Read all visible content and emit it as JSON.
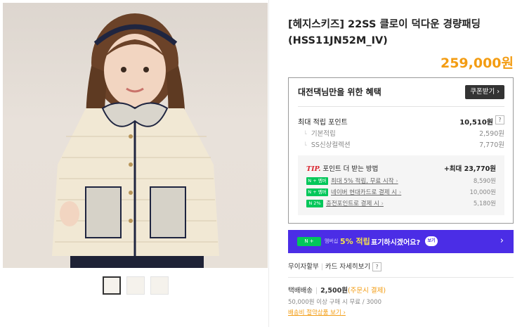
{
  "product": {
    "title": "[헤지스키즈] 22SS 클로이 덕다운 경량패딩 (HSS11JN52M_IV)",
    "price": "259,000원",
    "image_alt": "product-photo-child-wearing-ivory-padded-jacket",
    "thumbnail_count": 3
  },
  "benefit": {
    "heading": "대전댁님만을 위한 혜택",
    "coupon_button": "쿠폰받기 ›",
    "points": {
      "label": "최대 적립 포인트",
      "value": "10,510원",
      "help": "?"
    },
    "sub_points": [
      {
        "label": "기본적립",
        "value": "2,590원"
      },
      {
        "label": "SS신상컬렉션",
        "value": "7,770원"
      }
    ],
    "tip": {
      "tag": "TIP.",
      "heading": "포인트 더 받는 방법",
      "max": "+최대 23,770원",
      "rows": [
        {
          "badge": "N + 멤버십",
          "link": "최대 5% 적립, 무료 시작",
          "amount": "8,590원"
        },
        {
          "badge": "N + 멤버십",
          "link": "네이버 현대카드로 결제 시",
          "amount": "10,000원"
        },
        {
          "badge": "N 2%",
          "link": "충전포인트로 결제 시",
          "amount": "5,180원"
        }
      ]
    }
  },
  "banner": {
    "badge": "N +",
    "sub_badge": "멤버십",
    "highlight": "5% 적립",
    "text": "표기하시겠어요?",
    "pill": "보기",
    "arrow": "›"
  },
  "links": {
    "installment": "무이자할부",
    "card_detail": "카드 자세히보기",
    "help": "?"
  },
  "shipping": {
    "label": "택배배송",
    "fee": "2,500원",
    "condition": "(주문시 결제)",
    "info": "50,000원 이상 구매 시 무료 / 3000",
    "saving_link": "배송비 절약상품 보기"
  },
  "colors": {
    "price": "#f39c12",
    "banner": "#4b2de6",
    "naver_green": "#03c75a",
    "tip_red": "#d9232d"
  }
}
